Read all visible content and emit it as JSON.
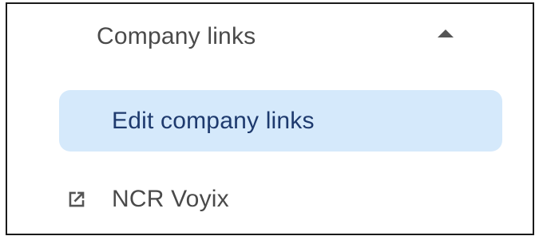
{
  "section": {
    "title": "Company links",
    "expand_icon": "caret-up-icon",
    "expanded": true
  },
  "edit_link": {
    "label": "Edit company links",
    "highlight_color": "#d5e9fb",
    "text_color": "#1e3a6e"
  },
  "links": [
    {
      "label": "NCR Voyix",
      "icon": "external-link-icon"
    }
  ]
}
